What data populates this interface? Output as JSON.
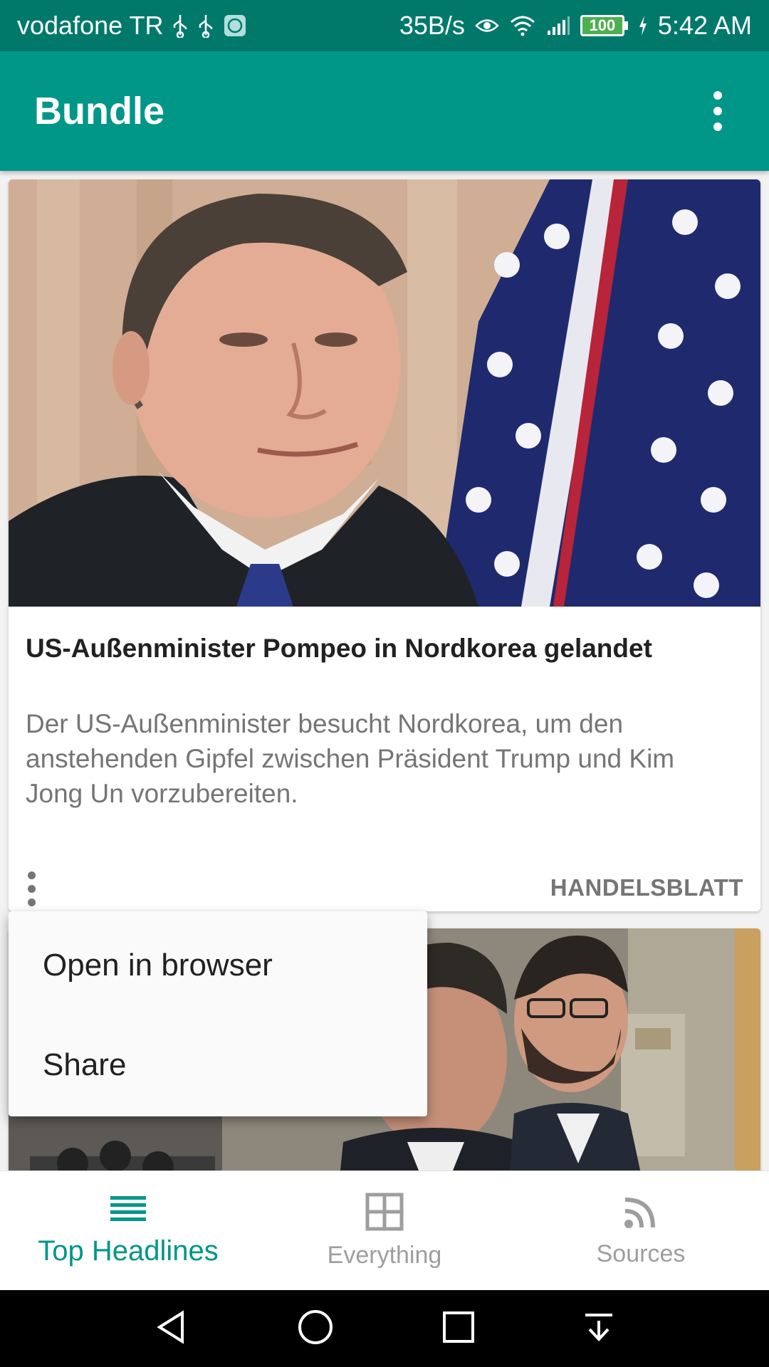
{
  "status_bar": {
    "carrier": "vodafone TR",
    "net_speed": "35B/s",
    "battery": "100",
    "time": "5:42 AM"
  },
  "app_bar": {
    "title": "Bundle",
    "menu_icon": "more-vert-icon"
  },
  "articles": [
    {
      "title": "US-Außenminister Pompeo in Nordkorea gelandet",
      "description": "Der US-Außenminister besucht Nordkorea, um den anstehenden Gipfel zwischen Präsident Trump und Kim Jong Un vorzubereiten.",
      "source": "HANDELSBLATT"
    }
  ],
  "popup_menu": {
    "items": [
      "Open in browser",
      "Share"
    ]
  },
  "bottom_nav": {
    "items": [
      {
        "label": "Top Headlines",
        "icon": "list-icon",
        "active": true
      },
      {
        "label": "Everything",
        "icon": "grid-icon",
        "active": false
      },
      {
        "label": "Sources",
        "icon": "rss-icon",
        "active": false
      }
    ]
  },
  "colors": {
    "primary": "#009688",
    "primary_dark": "#00796b",
    "text_primary": "#212121",
    "text_secondary": "#757575"
  }
}
